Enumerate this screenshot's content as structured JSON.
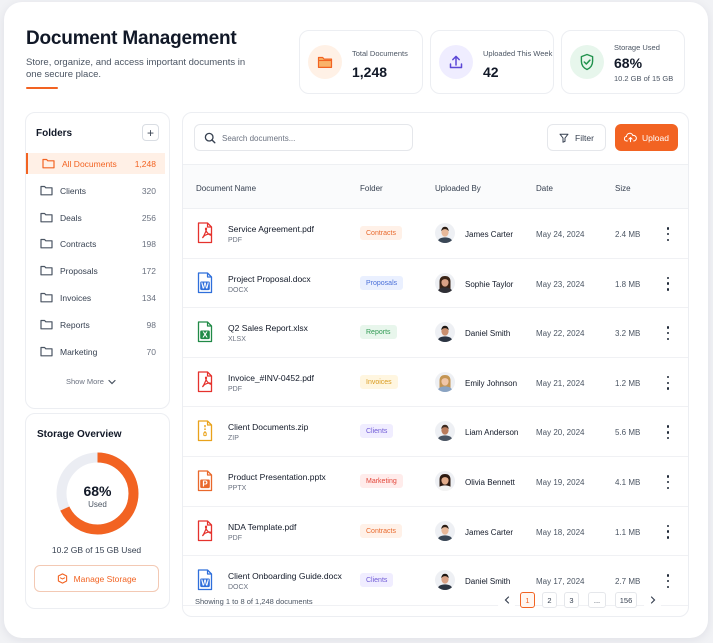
{
  "header": {
    "title": "Document Management",
    "subtitle": "Store, organize, and access important documents in one secure place."
  },
  "stats": [
    {
      "label": "Total Documents",
      "value": "1,248",
      "icon": "folder-icon"
    },
    {
      "label": "Uploaded This Week",
      "value": "42",
      "icon": "upload-icon"
    },
    {
      "label": "Storage Used",
      "value": "68%",
      "sub": "10.2 GB of 15 GB",
      "icon": "shield-check-icon"
    }
  ],
  "folders": {
    "title": "Folders",
    "items": [
      {
        "label": "All Documents",
        "count": "1,248",
        "active": true
      },
      {
        "label": "Clients",
        "count": "320"
      },
      {
        "label": "Deals",
        "count": "256"
      },
      {
        "label": "Contracts",
        "count": "198"
      },
      {
        "label": "Proposals",
        "count": "172"
      },
      {
        "label": "Invoices",
        "count": "134"
      },
      {
        "label": "Reports",
        "count": "98"
      },
      {
        "label": "Marketing",
        "count": "70"
      }
    ],
    "show_more": "Show More"
  },
  "storage": {
    "title": "Storage Overview",
    "percent": "68%",
    "percent_value": 0.68,
    "used_label": "Used",
    "used_text": "10.2 GB of 15 GB Used",
    "manage_label": "Manage Storage"
  },
  "toolbar": {
    "search_placeholder": "Search documents...",
    "filter_label": "Filter",
    "upload_label": "Upload"
  },
  "table": {
    "columns": [
      "Document Name",
      "Folder",
      "Uploaded By",
      "Date",
      "Size"
    ],
    "rows": [
      {
        "name": "Service Agreement.pdf",
        "type": "PDF",
        "folder": "Contracts",
        "user": "James Carter",
        "date": "May 24, 2024",
        "size": "2.4 MB"
      },
      {
        "name": "Project Proposal.docx",
        "type": "DOCX",
        "folder": "Proposals",
        "user": "Sophie Taylor",
        "date": "May 23, 2024",
        "size": "1.8 MB"
      },
      {
        "name": "Q2 Sales Report.xlsx",
        "type": "XLSX",
        "folder": "Reports",
        "user": "Daniel Smith",
        "date": "May 22, 2024",
        "size": "3.2 MB"
      },
      {
        "name": "Invoice_#INV-0452.pdf",
        "type": "PDF",
        "folder": "Invoices",
        "user": "Emily Johnson",
        "date": "May 21, 2024",
        "size": "1.2 MB"
      },
      {
        "name": "Client Documents.zip",
        "type": "ZIP",
        "folder": "Clients",
        "user": "Liam Anderson",
        "date": "May 20, 2024",
        "size": "5.6 MB"
      },
      {
        "name": "Product Presentation.pptx",
        "type": "PPTX",
        "folder": "Marketing",
        "user": "Olivia Bennett",
        "date": "May 19, 2024",
        "size": "4.1 MB"
      },
      {
        "name": "NDA Template.pdf",
        "type": "PDF",
        "folder": "Contracts",
        "user": "James Carter",
        "date": "May 18, 2024",
        "size": "1.1 MB"
      },
      {
        "name": "Client Onboarding Guide.docx",
        "type": "DOCX",
        "folder": "Clients",
        "user": "Daniel Smith",
        "date": "May 17, 2024",
        "size": "2.7 MB"
      }
    ]
  },
  "pagination": {
    "info": "Showing 1 to 8 of 1,248 documents",
    "pages": [
      "1",
      "2",
      "3",
      "...",
      "156"
    ],
    "current": "1"
  },
  "colors": {
    "accent": "#f26322",
    "tags": {
      "Contracts": [
        "#fff1e8",
        "#e8692c"
      ],
      "Proposals": [
        "#eaf0ff",
        "#4a6fd8"
      ],
      "Reports": [
        "#e8f6ec",
        "#2f9a52"
      ],
      "Invoices": [
        "#fff6e0",
        "#d99a1c"
      ],
      "Clients": [
        "#f0edff",
        "#6f5ad6"
      ],
      "Marketing": [
        "#ffeceb",
        "#e2473a"
      ]
    },
    "filetypes": {
      "PDF": "#e5322d",
      "DOCX": "#2f6fdb",
      "XLSX": "#218a47",
      "ZIP": "#e9a21b",
      "PPTX": "#e9682b"
    }
  }
}
